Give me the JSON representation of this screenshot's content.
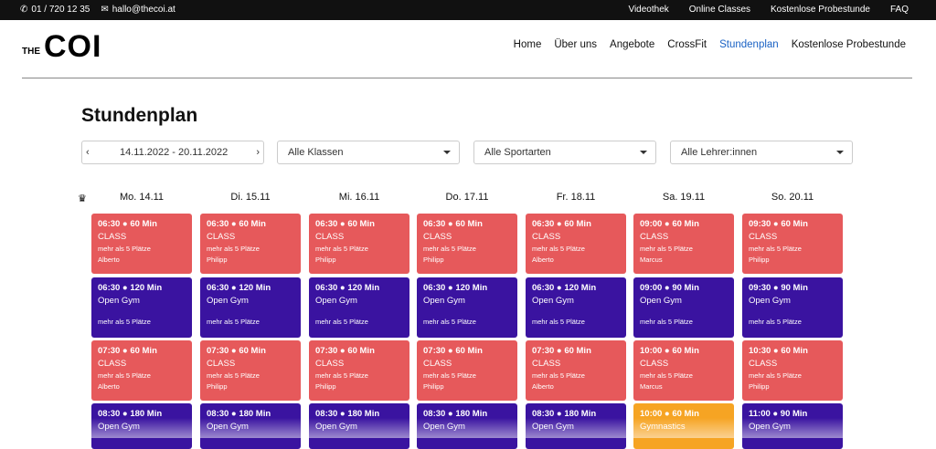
{
  "topbar": {
    "phone": "01 / 720 12 35",
    "email": "hallo@thecoi.at",
    "links": [
      "Videothek",
      "Online Classes",
      "Kostenlose Probestunde",
      "FAQ"
    ]
  },
  "logo": {
    "small": "THE",
    "big": "COI"
  },
  "nav": [
    "Home",
    "Über uns",
    "Angebote",
    "CrossFit",
    "Stundenplan",
    "Kostenlose Probestunde"
  ],
  "nav_active": "Stundenplan",
  "page_title": "Stundenplan",
  "filters": {
    "date_range": "14.11.2022 - 20.11.2022",
    "classes": "Alle Klassen",
    "sports": "Alle Sportarten",
    "teachers": "Alle Lehrer:innen"
  },
  "days": [
    "Mo. 14.11",
    "Di. 15.11",
    "Mi. 16.11",
    "Do. 17.11",
    "Fr. 18.11",
    "Sa. 19.11",
    "So. 20.11"
  ],
  "rows": [
    [
      {
        "time": "06:30 ● 60 Min",
        "name": "CLASS",
        "spots": "mehr als 5 Plätze",
        "coach": "Alberto",
        "color": "red"
      },
      {
        "time": "06:30 ● 60 Min",
        "name": "CLASS",
        "spots": "mehr als 5 Plätze",
        "coach": "Philipp",
        "color": "red"
      },
      {
        "time": "06:30 ● 60 Min",
        "name": "CLASS",
        "spots": "mehr als 5 Plätze",
        "coach": "Philipp",
        "color": "red"
      },
      {
        "time": "06:30 ● 60 Min",
        "name": "CLASS",
        "spots": "mehr als 5 Plätze",
        "coach": "Philipp",
        "color": "red"
      },
      {
        "time": "06:30 ● 60 Min",
        "name": "CLASS",
        "spots": "mehr als 5 Plätze",
        "coach": "Alberto",
        "color": "red"
      },
      {
        "time": "09:00 ● 60 Min",
        "name": "CLASS",
        "spots": "mehr als 5 Plätze",
        "coach": "Marcus",
        "color": "red"
      },
      {
        "time": "09:30 ● 60 Min",
        "name": "CLASS",
        "spots": "mehr als 5 Plätze",
        "coach": "Philipp",
        "color": "red"
      }
    ],
    [
      {
        "time": "06:30 ● 120 Min",
        "name": "Open Gym",
        "spots": "mehr als 5 Plätze",
        "coach": "",
        "color": "blue"
      },
      {
        "time": "06:30 ● 120 Min",
        "name": "Open Gym",
        "spots": "mehr als 5 Plätze",
        "coach": "",
        "color": "blue"
      },
      {
        "time": "06:30 ● 120 Min",
        "name": "Open Gym",
        "spots": "mehr als 5 Plätze",
        "coach": "",
        "color": "blue"
      },
      {
        "time": "06:30 ● 120 Min",
        "name": "Open Gym",
        "spots": "mehr als 5 Plätze",
        "coach": "",
        "color": "blue"
      },
      {
        "time": "06:30 ● 120 Min",
        "name": "Open Gym",
        "spots": "mehr als 5 Plätze",
        "coach": "",
        "color": "blue"
      },
      {
        "time": "09:00 ● 90 Min",
        "name": "Open Gym",
        "spots": "mehr als 5 Plätze",
        "coach": "",
        "color": "blue"
      },
      {
        "time": "09:30 ● 90 Min",
        "name": "Open Gym",
        "spots": "mehr als 5 Plätze",
        "coach": "",
        "color": "blue"
      }
    ],
    [
      {
        "time": "07:30 ● 60 Min",
        "name": "CLASS",
        "spots": "mehr als 5 Plätze",
        "coach": "Alberto",
        "color": "red"
      },
      {
        "time": "07:30 ● 60 Min",
        "name": "CLASS",
        "spots": "mehr als 5 Plätze",
        "coach": "Philipp",
        "color": "red"
      },
      {
        "time": "07:30 ● 60 Min",
        "name": "CLASS",
        "spots": "mehr als 5 Plätze",
        "coach": "Philipp",
        "color": "red"
      },
      {
        "time": "07:30 ● 60 Min",
        "name": "CLASS",
        "spots": "mehr als 5 Plätze",
        "coach": "Philipp",
        "color": "red"
      },
      {
        "time": "07:30 ● 60 Min",
        "name": "CLASS",
        "spots": "mehr als 5 Plätze",
        "coach": "Alberto",
        "color": "red"
      },
      {
        "time": "10:00 ● 60 Min",
        "name": "CLASS",
        "spots": "mehr als 5 Plätze",
        "coach": "Marcus",
        "color": "red"
      },
      {
        "time": "10:30 ● 60 Min",
        "name": "CLASS",
        "spots": "mehr als 5 Plätze",
        "coach": "Philipp",
        "color": "red"
      }
    ],
    [
      {
        "time": "08:30 ● 180 Min",
        "name": "Open Gym",
        "spots": "",
        "coach": "",
        "color": "blue"
      },
      {
        "time": "08:30 ● 180 Min",
        "name": "Open Gym",
        "spots": "",
        "coach": "",
        "color": "blue"
      },
      {
        "time": "08:30 ● 180 Min",
        "name": "Open Gym",
        "spots": "",
        "coach": "",
        "color": "blue"
      },
      {
        "time": "08:30 ● 180 Min",
        "name": "Open Gym",
        "spots": "",
        "coach": "",
        "color": "blue"
      },
      {
        "time": "08:30 ● 180 Min",
        "name": "Open Gym",
        "spots": "",
        "coach": "",
        "color": "blue"
      },
      {
        "time": "10:00 ● 60 Min",
        "name": "Gymnastics",
        "spots": "",
        "coach": "",
        "color": "orange"
      },
      {
        "time": "11:00 ● 90 Min",
        "name": "Open Gym",
        "spots": "",
        "coach": "",
        "color": "blue"
      }
    ]
  ],
  "colors": {
    "red": "#e6595b",
    "blue": "#3a13a0",
    "orange": "#f6a423",
    "active_nav": "#1a62c4"
  }
}
